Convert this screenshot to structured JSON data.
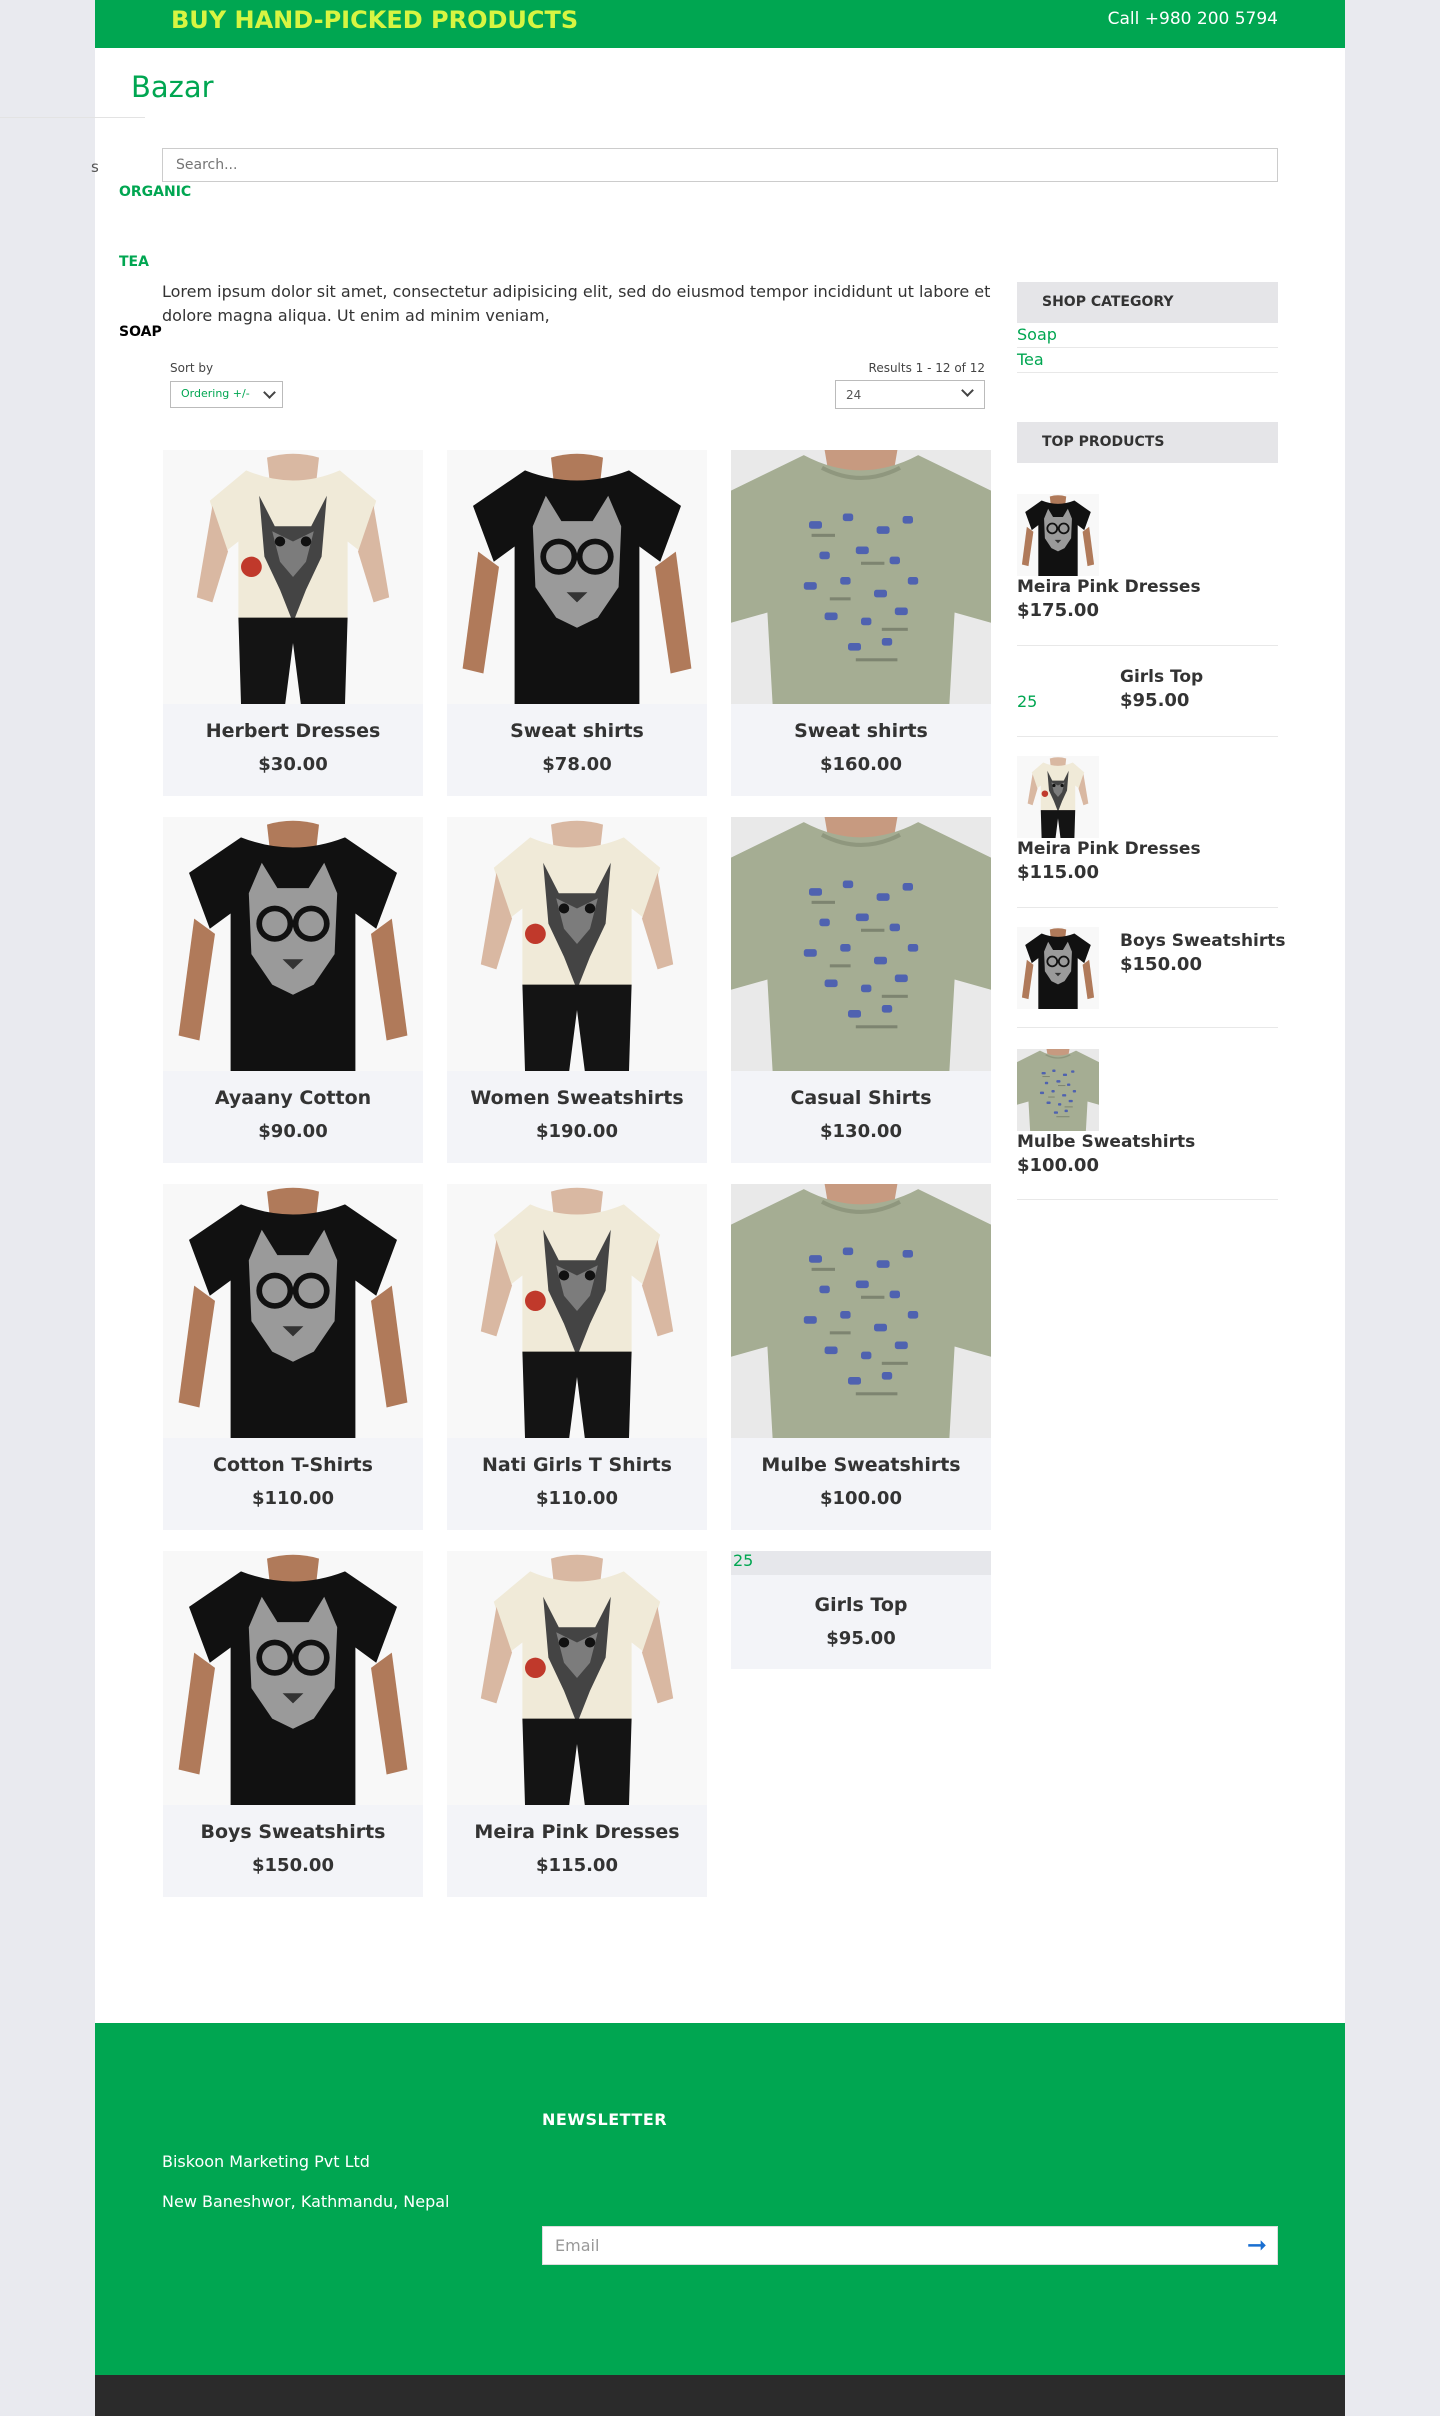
{
  "topbar": {
    "tagline": "BUY HAND-PICKED PRODUCTS",
    "phone": "Call +980 200 5794"
  },
  "brand": {
    "logo": "Bazar"
  },
  "nav": {
    "fragment": "s",
    "items": [
      "ORGANIC",
      "TEA",
      "SOAP"
    ]
  },
  "search": {
    "placeholder": "Search..."
  },
  "intro": "Lorem ipsum dolor sit amet, consectetur adipisicing elit, sed do eiusmod tempor incididunt ut labore et dolore magna aliqua. Ut enim ad minim veniam,",
  "toolbar": {
    "sort_label": "Sort by",
    "sort_value": "Ordering +/-",
    "results": "Results 1 - 12 of 12",
    "per_page": "24"
  },
  "products": [
    {
      "name": "Herbert Dresses",
      "price": "$30.00",
      "image": "wolf-tee"
    },
    {
      "name": "Sweat shirts",
      "price": "$78.00",
      "image": "cat-tee"
    },
    {
      "name": "Sweat shirts",
      "price": "$160.00",
      "image": "green-tee"
    },
    {
      "name": "Ayaany Cotton",
      "price": "$90.00",
      "image": "cat-tee"
    },
    {
      "name": "Women Sweatshirts",
      "price": "$190.00",
      "image": "wolf-tee"
    },
    {
      "name": "Casual Shirts",
      "price": "$130.00",
      "image": "green-tee"
    },
    {
      "name": "Cotton T-Shirts",
      "price": "$110.00",
      "image": "cat-tee"
    },
    {
      "name": "Nati Girls T Shirts",
      "price": "$110.00",
      "image": "wolf-tee"
    },
    {
      "name": "Mulbe Sweatshirts",
      "price": "$100.00",
      "image": "green-tee"
    },
    {
      "name": "Boys Sweatshirts",
      "price": "$150.00",
      "image": "cat-tee"
    },
    {
      "name": "Meira Pink Dresses",
      "price": "$115.00",
      "image": "wolf-tee"
    },
    {
      "name": "Girls Top",
      "price": "$95.00",
      "image": "broken",
      "broken_alt": "25"
    }
  ],
  "sidebar": {
    "shop_category_title": "SHOP CATEGORY",
    "categories": [
      "Soap",
      "Tea"
    ],
    "top_products_title": "TOP PRODUCTS",
    "top_products": [
      {
        "name": "Meira Pink Dresses",
        "price": "$175.00",
        "image": "cat-tee"
      },
      {
        "name": "Girls Top",
        "price": "$95.00",
        "image": "broken",
        "broken_alt": "25"
      },
      {
        "name": "Meira Pink Dresses",
        "price": "$115.00",
        "image": "wolf-tee"
      },
      {
        "name": "Boys Sweatshirts",
        "price": "$150.00",
        "image": "cat-tee"
      },
      {
        "name": "Mulbe Sweatshirts",
        "price": "$100.00",
        "image": "green-tee"
      }
    ]
  },
  "footer": {
    "company": "Biskoon Marketing Pvt Ltd",
    "address": "New Baneshwor, Kathmandu, Nepal",
    "newsletter_title": "NEWSLETTER",
    "email_placeholder": "Email",
    "submit_icon": "arrow-right-icon"
  },
  "colors": {
    "brand": "#00a651",
    "tagline": "#d7f542",
    "card_bg": "#f3f4f8",
    "footer": "#00a651",
    "bottom_bar": "#2b2b2b"
  }
}
